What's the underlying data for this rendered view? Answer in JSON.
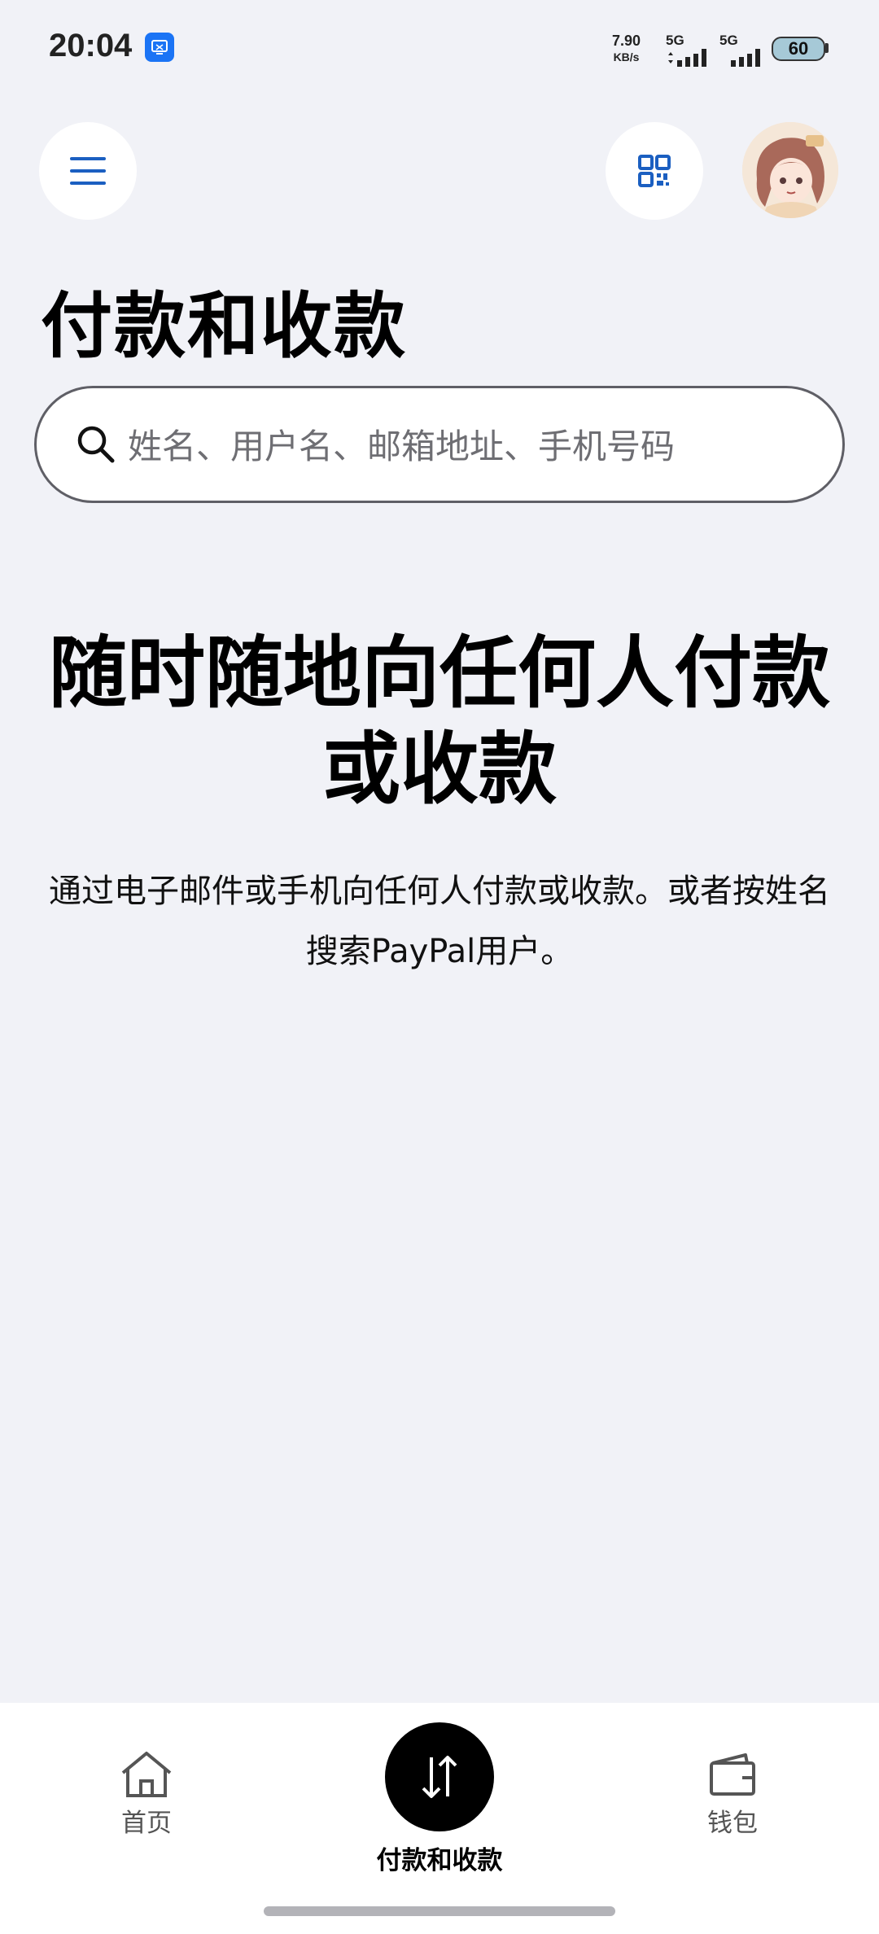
{
  "status_bar": {
    "time": "20:04",
    "net_speed": "7.90",
    "net_unit": "KB/s",
    "sim1_label": "5G",
    "sim2_label": "5G",
    "battery": "60"
  },
  "header": {
    "menu_icon": "hamburger-menu-icon",
    "qr_icon": "qr-code-icon",
    "avatar": "user-avatar"
  },
  "page": {
    "title": "付款和收款",
    "search_placeholder": "姓名、用户名、邮箱地址、手机号码",
    "hero_line1": "随时随地向任何人付款",
    "hero_line2": "或收款",
    "subtitle": "通过电子邮件或手机向任何人付款或收款。或者按姓名搜索PayPal用户。"
  },
  "tabbar": {
    "home_label": "首页",
    "pay_label": "付款和收款",
    "wallet_label": "钱包"
  },
  "colors": {
    "background": "#f1f2f7",
    "accent_blue": "#1b5fc1",
    "active_tab": "#000000"
  }
}
